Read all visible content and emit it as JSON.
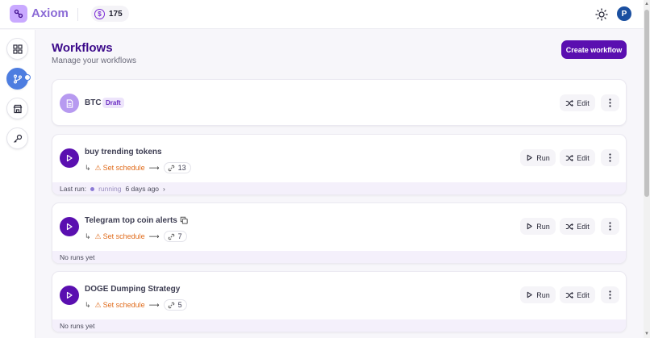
{
  "app": {
    "name": "Axiom",
    "credits": "175",
    "user_initial": "P"
  },
  "header": {
    "title": "Workflows",
    "subtitle": "Manage your workflows",
    "create_label": "Create workflow"
  },
  "labels": {
    "run": "Run",
    "edit": "Edit",
    "set_schedule": "Set schedule",
    "last_run": "Last run:",
    "no_runs": "No runs yet"
  },
  "workflows": [
    {
      "name": "BTC",
      "status_badge": "Draft"
    },
    {
      "name": "buy trending tokens",
      "steps": "13",
      "last_run_status": "running",
      "last_run_time": "6 days ago"
    },
    {
      "name": "Telegram top coin alerts",
      "steps": "7"
    },
    {
      "name": "DOGE Dumping Strategy",
      "steps": "5"
    }
  ],
  "colors": {
    "accent": "#5a0fb0",
    "warning": "#e06c1c",
    "sidebar_active": "#4d7de0"
  }
}
